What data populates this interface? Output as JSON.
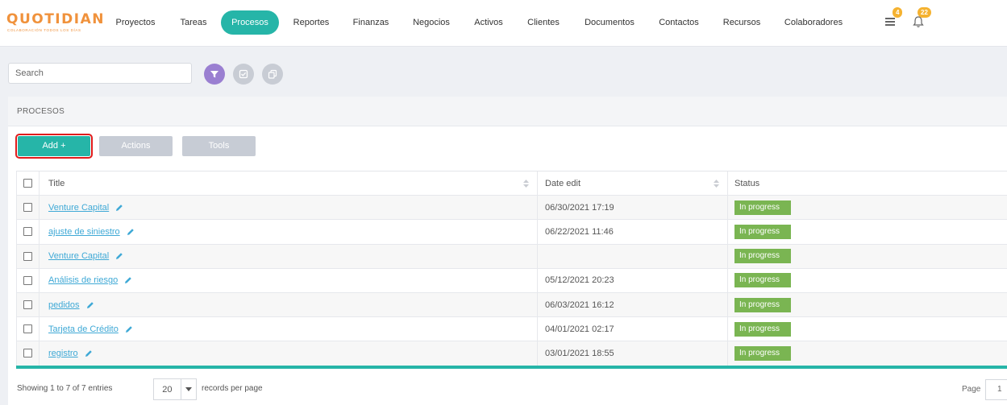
{
  "brand": {
    "name": "QUOTIDIAN",
    "tagline": "COLABORACIÓN TODOS LOS DÍAS"
  },
  "nav": {
    "items": [
      {
        "label": "Proyectos"
      },
      {
        "label": "Tareas"
      },
      {
        "label": "Procesos",
        "active": true
      },
      {
        "label": "Reportes"
      },
      {
        "label": "Finanzas"
      },
      {
        "label": "Negocios"
      },
      {
        "label": "Activos"
      },
      {
        "label": "Clientes"
      },
      {
        "label": "Documentos"
      },
      {
        "label": "Contactos"
      },
      {
        "label": "Recursos"
      },
      {
        "label": "Colaboradores"
      }
    ],
    "messages_count": "4",
    "notifications_count": "22"
  },
  "search": {
    "placeholder": "Search",
    "value": ""
  },
  "toolbar_icons": [
    "filter-icon",
    "check-circle-icon",
    "copy-icon"
  ],
  "panel": {
    "title": "PROCESOS",
    "add_label": "Add +",
    "actions_label": "Actions",
    "tools_label": "Tools"
  },
  "table": {
    "columns": {
      "title": "Title",
      "date_edit": "Date edit",
      "status": "Status"
    },
    "rows": [
      {
        "title": "Venture Capital",
        "date_edit": "06/30/2021 17:19",
        "status": "In progress"
      },
      {
        "title": "ajuste de siniestro",
        "date_edit": "06/22/2021 11:46",
        "status": "In progress"
      },
      {
        "title": "Venture Capital",
        "date_edit": "",
        "status": "In progress"
      },
      {
        "title": "Análisis de riesgo",
        "date_edit": "05/12/2021 20:23",
        "status": "In progress"
      },
      {
        "title": "pedidos",
        "date_edit": "06/03/2021 16:12",
        "status": "In progress"
      },
      {
        "title": "Tarjeta de Crédito",
        "date_edit": "04/01/2021 02:17",
        "status": "In progress"
      },
      {
        "title": "registro",
        "date_edit": "03/01/2021 18:55",
        "status": "In progress"
      }
    ]
  },
  "footer": {
    "info": "Showing 1 to 7 of 7 entries",
    "page_size": "20",
    "records_per_page": "records per page",
    "page_label": "Page",
    "page_value": "1"
  },
  "colors": {
    "accent": "#26b5a8",
    "brand": "#f0923c",
    "status_in_progress": "#7ab552",
    "filter": "#9a7fd1",
    "badge": "#f5b230",
    "link": "#3fa9d6",
    "highlight_outline": "#e01b1b"
  }
}
